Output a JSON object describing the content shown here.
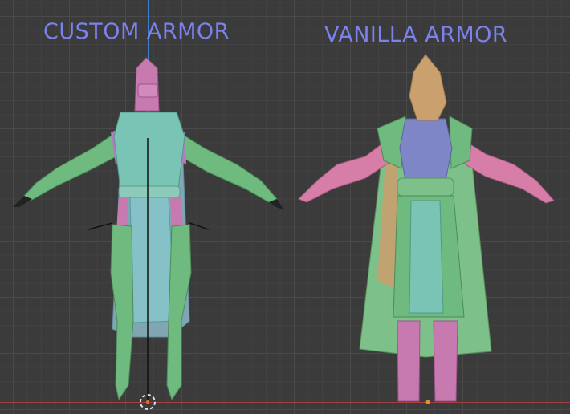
{
  "labels": {
    "custom": "CUSTOM ARMOR",
    "vanilla": "VANILLA ARMOR"
  },
  "colors": {
    "label": "#7b82ee",
    "green": "#6fba7e",
    "teal": "#79c4b4",
    "pink": "#c77ab0",
    "purple": "#9a88cf",
    "blue_purple": "#7f86c8",
    "tan": "#c9a06e",
    "grid_bg": "#3b3b3b",
    "axis_x": "#a04040",
    "axis_z": "#3d7fcc"
  }
}
